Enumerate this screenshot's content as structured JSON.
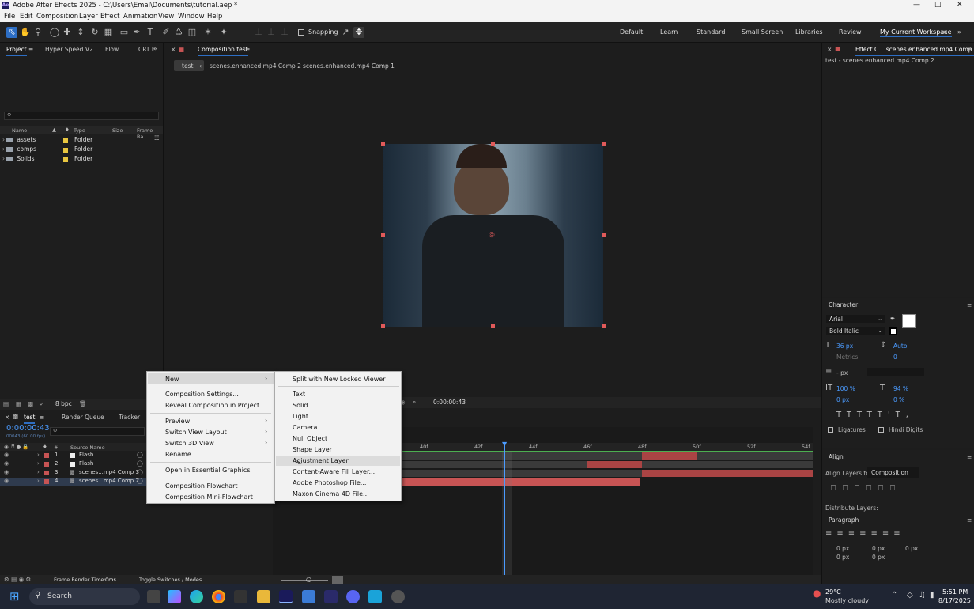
{
  "app": {
    "title": "Adobe After Effects 2025 - C:\\Users\\Emal\\Documents\\tutorial.aep *",
    "logo": "Ae"
  },
  "menubar": [
    "File",
    "Edit",
    "Composition",
    "Layer",
    "Effect",
    "Animation",
    "View",
    "Window",
    "Help"
  ],
  "toolbar": {
    "snapping_label": "Snapping",
    "workspaces": [
      "Default",
      "Learn",
      "Standard",
      "Small Screen",
      "Libraries",
      "Review",
      "My Current Workspace"
    ]
  },
  "project_panel": {
    "tabs": [
      "Project",
      "Hyper Speed V2",
      "Flow",
      "CRT F"
    ],
    "search_placeholder": "",
    "columns": [
      "Name",
      "Type",
      "Size",
      "Frame Ra..."
    ],
    "items": [
      {
        "name": "assets",
        "type": "Folder"
      },
      {
        "name": "comps",
        "type": "Folder"
      },
      {
        "name": "Solids",
        "type": "Folder"
      }
    ],
    "bpc": "8 bpc"
  },
  "composition_panel": {
    "tab_label": "Composition test",
    "breadcrumbs": [
      "test",
      "scenes.enhanced.mp4 Comp 2",
      "scenes.enhanced.mp4 Comp 1"
    ],
    "timecode": "0:00:00:43"
  },
  "effect_panel": {
    "tab_label": "Effect C... scenes.enhanced.mp4 Comp 2",
    "subtitle": "test - scenes.enhanced.mp4 Comp 2"
  },
  "character_panel": {
    "title": "Character",
    "font": "Arial",
    "style": "Bold Italic",
    "size": "36 px",
    "leading": "Auto",
    "kerning": "Metrics",
    "tracking": "0",
    "stroke": "- px",
    "vscale": "100 %",
    "hscale": "94 %",
    "baseline": "0 px",
    "tsume": "0 %",
    "ligatures": "Ligatures",
    "hindi_digits": "Hindi Digits"
  },
  "align_panel": {
    "title": "Align",
    "align_to_label": "Align Layers to:",
    "align_to_value": "Composition",
    "distribute_label": "Distribute Layers:"
  },
  "paragraph_panel": {
    "title": "Paragraph",
    "values": [
      "0 px",
      "0 px",
      "0 px",
      "0 px",
      "0 px"
    ]
  },
  "timeline": {
    "tabs": [
      "test",
      "Render Queue",
      "Tracker"
    ],
    "timecode": "0:00:00:43",
    "timecode_sub": "00043 (60.00 fps)",
    "source_name_header": "Source Name",
    "hash_header": "#",
    "layers": [
      {
        "num": "1",
        "name": "Flash"
      },
      {
        "num": "2",
        "name": "Flash"
      },
      {
        "num": "3",
        "name": "scenes...mp4 Comp 3"
      },
      {
        "num": "4",
        "name": "scenes...mp4 Comp 2"
      }
    ],
    "ruler": [
      "40f",
      "42f",
      "44f",
      "46f",
      "48f",
      "50f",
      "52f",
      "54f"
    ],
    "footer_render_time_label": "Frame Render Time:",
    "footer_render_time": "0ms",
    "footer_toggle": "Toggle Switches / Modes"
  },
  "context_menu": {
    "items": [
      {
        "label": "New",
        "submenu": true
      },
      {
        "label": "Composition Settings...",
        "submenu": false
      },
      {
        "label": "Reveal Composition in Project",
        "submenu": false
      },
      {
        "label": "Preview",
        "submenu": true
      },
      {
        "label": "Switch View Layout",
        "submenu": true
      },
      {
        "label": "Switch 3D View",
        "submenu": true
      },
      {
        "label": "Rename",
        "submenu": false
      },
      {
        "label": "Open in Essential Graphics",
        "submenu": false
      },
      {
        "label": "Composition Flowchart",
        "submenu": false
      },
      {
        "label": "Composition Mini-Flowchart",
        "submenu": false
      }
    ]
  },
  "submenu": {
    "items": [
      "Split with New Locked Viewer",
      "Text",
      "Solid...",
      "Light...",
      "Camera...",
      "Null Object",
      "Shape Layer",
      "Adjustment Layer",
      "Content-Aware Fill Layer...",
      "Adobe Photoshop File...",
      "Maxon Cinema 4D File..."
    ],
    "hovered": "Adjustment Layer"
  },
  "taskbar": {
    "search_label": "Search",
    "weather_temp": "29°C",
    "weather_desc": "Mostly cloudy",
    "time": "5:51 PM",
    "date": "8/17/2025"
  },
  "colors": {
    "accent": "#2d6ec4",
    "label_red": "#c75454",
    "playhead": "#4b9bff"
  }
}
